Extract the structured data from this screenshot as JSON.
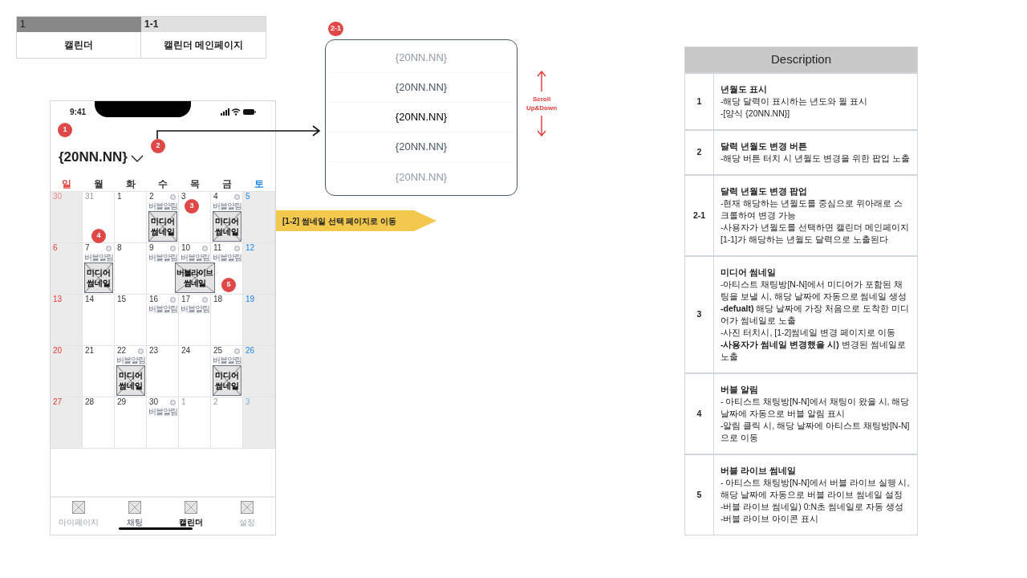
{
  "page_header": {
    "section_number": "1",
    "page_number": "1-1",
    "section": "캘린더",
    "page": "캘린더 메인페이지"
  },
  "phone": {
    "time": "9:41",
    "title": "{20NN.NN}",
    "markers": [
      "1",
      "2",
      "3",
      "4",
      "5"
    ],
    "weekdays": [
      {
        "label": "일",
        "color": "#e53935"
      },
      {
        "label": "월",
        "color": "#333333"
      },
      {
        "label": "화",
        "color": "#333333"
      },
      {
        "label": "수",
        "color": "#333333"
      },
      {
        "label": "목",
        "color": "#333333"
      },
      {
        "label": "금",
        "color": "#333333"
      },
      {
        "label": "토",
        "color": "#1e88e5"
      }
    ],
    "weeks": [
      {
        "days": [
          {
            "day": "30",
            "other_month": true
          },
          {
            "day": "31",
            "other_month": true
          },
          {
            "day": "1",
            "other_month": false
          },
          {
            "day": "2",
            "other_month": false,
            "bubble": "버블알림",
            "thumbnail": {
              "kind": "media",
              "label": "미디어 썸네일"
            }
          },
          {
            "day": "3",
            "other_month": false
          },
          {
            "day": "4",
            "other_month": false,
            "bubble": "버블알림",
            "thumbnail": {
              "kind": "media",
              "label": "미디어 썸네일"
            }
          },
          {
            "day": "5",
            "other_month": false
          }
        ]
      },
      {
        "days": [
          {
            "day": "6",
            "other_month": false
          },
          {
            "day": "7",
            "other_month": false,
            "bubble": "버블알림",
            "thumbnail": {
              "kind": "media",
              "label": "미디어 썸네일"
            }
          },
          {
            "day": "8",
            "other_month": false
          },
          {
            "day": "9",
            "other_month": false,
            "bubble": "버블알림"
          },
          {
            "day": "10",
            "other_month": false,
            "bubble": "버블알림",
            "thumbnail": {
              "kind": "live",
              "label": "버블라이브 썸네일"
            }
          },
          {
            "day": "11",
            "other_month": false,
            "bubble": "버블알림"
          },
          {
            "day": "12",
            "other_month": false
          }
        ]
      },
      {
        "days": [
          {
            "day": "13",
            "other_month": false
          },
          {
            "day": "14",
            "other_month": false
          },
          {
            "day": "15",
            "other_month": false
          },
          {
            "day": "16",
            "other_month": false,
            "bubble": "버블알림"
          },
          {
            "day": "17",
            "other_month": false,
            "bubble": "버블알림"
          },
          {
            "day": "18",
            "other_month": false
          },
          {
            "day": "19",
            "other_month": false
          }
        ]
      },
      {
        "days": [
          {
            "day": "20",
            "other_month": false
          },
          {
            "day": "21",
            "other_month": false
          },
          {
            "day": "22",
            "other_month": false,
            "bubble": "버블알림",
            "thumbnail": {
              "kind": "media",
              "label": "미디어 썸네일"
            }
          },
          {
            "day": "23",
            "other_month": false
          },
          {
            "day": "24",
            "other_month": false
          },
          {
            "day": "25",
            "other_month": false,
            "bubble": "버블알림",
            "thumbnail": {
              "kind": "media",
              "label": "미디어 썸네일"
            }
          },
          {
            "day": "26",
            "other_month": false
          }
        ]
      },
      {
        "days": [
          {
            "day": "27",
            "other_month": false
          },
          {
            "day": "28",
            "other_month": false
          },
          {
            "day": "29",
            "other_month": false
          },
          {
            "day": "30",
            "other_month": false,
            "bubble": "버블알림"
          },
          {
            "day": "1",
            "other_month": true
          },
          {
            "day": "2",
            "other_month": true
          },
          {
            "day": "3",
            "other_month": true
          }
        ]
      }
    ],
    "tabs": [
      {
        "label": "마이페이지",
        "selected": false,
        "disabled": true
      },
      {
        "label": "채팅",
        "selected": false,
        "disabled": false
      },
      {
        "label": "캘린더",
        "selected": true,
        "disabled": false
      },
      {
        "label": "설정",
        "selected": false,
        "disabled": true
      }
    ]
  },
  "callout": "[1-2] 썸네일 선택 페이지로 이동",
  "popup": {
    "marker": "2-1",
    "scroll_hint": "Scroll Up&Down",
    "items": [
      {
        "label": "{20NN.NN}",
        "selected": false,
        "faded": true
      },
      {
        "label": "{20NN.NN}",
        "selected": false,
        "faded": false
      },
      {
        "label": "{20NN.NN}",
        "selected": true,
        "faded": false
      },
      {
        "label": "{20NN.NN}",
        "selected": false,
        "faded": false
      },
      {
        "label": "{20NN.NN}",
        "selected": false,
        "faded": true
      }
    ]
  },
  "description": {
    "title": "Description",
    "rows": [
      {
        "number": "1",
        "title": "년월도 표시",
        "lines": [
          "-해당 달력이 표시하는 년도와 월 표시",
          "-[양식 {20NN.NN}]"
        ]
      },
      {
        "number": "2",
        "title": "달력 년월도 변경 버튼",
        "lines": [
          "-해당 버튼 터치 시 년월도 변경을 위한 팝업 노출"
        ]
      },
      {
        "number": "2-1",
        "title": "달력 년월도 변경 팝업",
        "lines": [
          "-현재 해당하는 년월도를 중심으로 위아래로 스크롤하여 변경 가능",
          "-사용자가 년월도를 선택하면 캘린더 메인페이지 [1-1]가 해당하는 년월도 달력으로 노출된다"
        ]
      },
      {
        "number": "3",
        "title": "미디어 썸네일",
        "lines": [
          "-아티스트 채팅방[N-N]에서 미디어가 포함된 채팅을 보낼 시, 해당 날짜에 자동으로 썸네일 생성",
          "**-defualt)** 해당 날짜에 가장 처음으로 도착한 미디어가 썸네일로 노출",
          "-사진 터치시, [1-2]썸네일 변경 페이지로 이동",
          "**-사용자가 썸네일 변경했을 시)** 변경된 썸네일로 노출"
        ]
      },
      {
        "number": "4",
        "title": "버블 알림",
        "lines": [
          "- 아티스트 채팅방[N-N]에서 채팅이 왔을 시, 해당 날짜에 자동으로 버블 알림 표시",
          "-알림 클릭 시, 해당 날짜에 아티스트 채팅방[N-N]으로 이동"
        ]
      },
      {
        "number": "5",
        "title": "버블 라이브 썸네일",
        "lines": [
          "- 아티스트 채팅방[N-N]에서 버블 라이브 실행 시, 해당 날짜에 자동으로 버블 라이브 썸네일 설정",
          "-버블 라이브 썸네일) 0:N초 썸네일로 자동 생성",
          "-버블 라이브 아이콘 표시"
        ]
      }
    ]
  }
}
